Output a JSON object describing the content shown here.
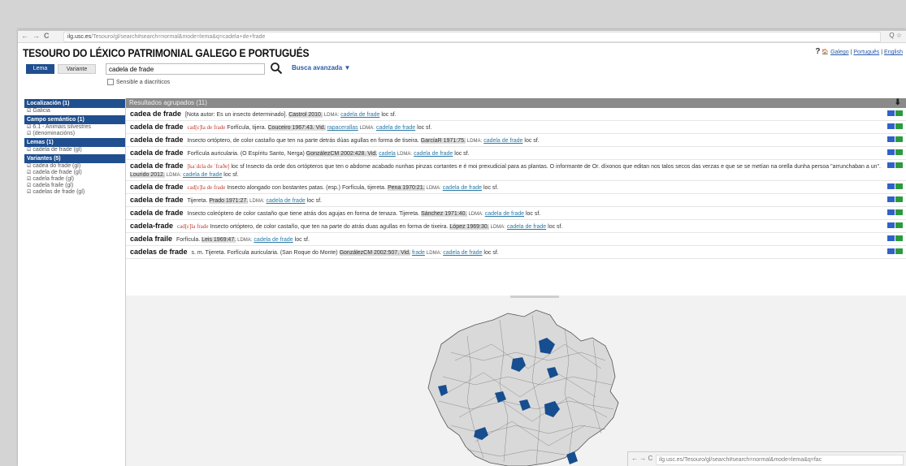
{
  "browser": {
    "url_host": "ilg.usc.es",
    "url_rest": "/Tesouro/gl/search#search=normal&mode=lema&q=cadela+de+frade",
    "toolbar_right": "Q ☆"
  },
  "site": {
    "title": "TESOURO DO LÉXICO PATRIMONIAL GALEGO E PORTUGUÉS",
    "help": "?",
    "links": [
      "Galego",
      "Português",
      "English"
    ]
  },
  "search": {
    "lema_label": "Lema",
    "variante_label": "Variante",
    "value": "cadela de frade",
    "advanced_label": "Busca avanzada ▼",
    "sensitive_label": "Sensible a diacríticos"
  },
  "sidebar": [
    {
      "heading": "Localización (1)",
      "items": [
        "Galicia"
      ]
    },
    {
      "heading": "Campo semántico (1)",
      "items": [
        "6.1 - Animais silvestres",
        "(denominacións)"
      ]
    },
    {
      "heading": "Lemas (1)",
      "items": [
        "cadela de frade (gl)"
      ]
    },
    {
      "heading": "Variantes (5)",
      "items": [
        "cadea do frade (gl)",
        "cadela de frade (gl)",
        "cadela frade (gl)",
        "cadela fraile (gl)",
        "cadelas de frade (gl)"
      ]
    }
  ],
  "results": {
    "header": "Resultados agrupados (11)",
    "download_icon": "⬇",
    "rows": [
      {
        "lemma": "cadea de frade",
        "pron": "",
        "text": "[Nota autor: Es un insecto determinado].",
        "source": "Castrol 2010.",
        "ldma": "LDMA:",
        "link": "cadela de frade",
        "tail": "loc sf."
      },
      {
        "lemma": "cadela de frade",
        "pron": "cad[ɛ]la de frade",
        "text": "Forfícula, tijera.",
        "source": "Couceiro 1967:43. Vid.",
        "ldma": "LDMA:",
        "link": "rapacerallas",
        "extra_link": "cadela de frade",
        "tail": "loc sf."
      },
      {
        "lemma": "cadela de frade",
        "pron": "",
        "text": "Insecto ortóptero, de color castaño que ten na parte detrás dúas agullas en forma de tiseira.",
        "source": "GarcíaR 1971:75.",
        "ldma": "LDMA:",
        "link": "cadela de frade",
        "tail": "loc sf."
      },
      {
        "lemma": "cadela de frade",
        "pron": "",
        "text": "Forfícula auricularia. (O Espíritu Santo, Nerga)",
        "source": "GonzálezCM 2002:428. Vid.",
        "ldma": "LDMA:",
        "link": "cadela",
        "extra_link": "cadela de frade",
        "tail": "loc sf."
      },
      {
        "lemma": "cadela de frade",
        "pron": "[kaˈdɛla de ˈfraðe]",
        "text": "loc sf Insecto da orde dos ortópteros que ten o abdome acabado nunhas pinzas cortantes e é moi prexudicial para as plantas. O informante de Or. díxonos que editan nos talos secos das verzas e que se se metían na orella dunha persoa \"arrunchaban a un\".",
        "source": "Lourido 2012.",
        "ldma": "LDMA:",
        "link": "cadela de frade",
        "tail": "loc sf.",
        "tall": true
      },
      {
        "lemma": "cadela de frade",
        "pron": "cad[ɛ]la de frade",
        "text": "Insecto alongado con bostantes patas. (esp.) Forfícula, tijereta.",
        "source": "Pena 1970:21.",
        "ldma": "LDMA:",
        "link": "cadela de frade",
        "tail": "loc sf."
      },
      {
        "lemma": "cadela de frade",
        "pron": "",
        "text": "Tijereta.",
        "source": "Prado 1971:27.",
        "ldma": "LDMA:",
        "link": "cadela de frade",
        "tail": "loc sf."
      },
      {
        "lemma": "cadela de frade",
        "pron": "",
        "text": "Insecto coleóptero de color castaño que tiene atrás dos agujas en forma de tenaza. Tijereta.",
        "source": "Sánchez 1971:40.",
        "ldma": "LDMA:",
        "link": "cadela de frade",
        "tail": "loc sf."
      },
      {
        "lemma": "cadela-frade",
        "pron": "cad[ɛ]la frade",
        "text": "Insecto ortóptero, de color castaño, que ten na parte do atrás duas agullas en forma de tixeira.",
        "source": "López 1969:30.",
        "ldma": "LDMA:",
        "link": "cadela de frade",
        "tail": "loc sf."
      },
      {
        "lemma": "cadela fraile",
        "pron": "",
        "text": "Forfícula.",
        "source": "Leis 1969:47.",
        "ldma": "LDMA:",
        "link": "cadela de frade",
        "tail": "loc sf."
      },
      {
        "lemma": "cadelas de frade",
        "pron": "",
        "text": "s. m. Tijereta. Forfícula auricularia. (San Roque do Monte)",
        "source": "GonzálezCM 2002:507. Vid.",
        "ldma": "LDMA:",
        "link": "frade",
        "extra_link": "cadela de frade",
        "tail": "loc sf."
      }
    ]
  },
  "colors": {
    "accent": "#1f4f8f",
    "map_highlight": "#164e8f",
    "badge_blue": "#2f62c9",
    "badge_green": "#2c9a3c"
  },
  "mini_browser": {
    "url_host": "ilg.usc.es",
    "url_rest": "/Tesouro/gl/search#search=normal&mode=lema&q=fac"
  }
}
